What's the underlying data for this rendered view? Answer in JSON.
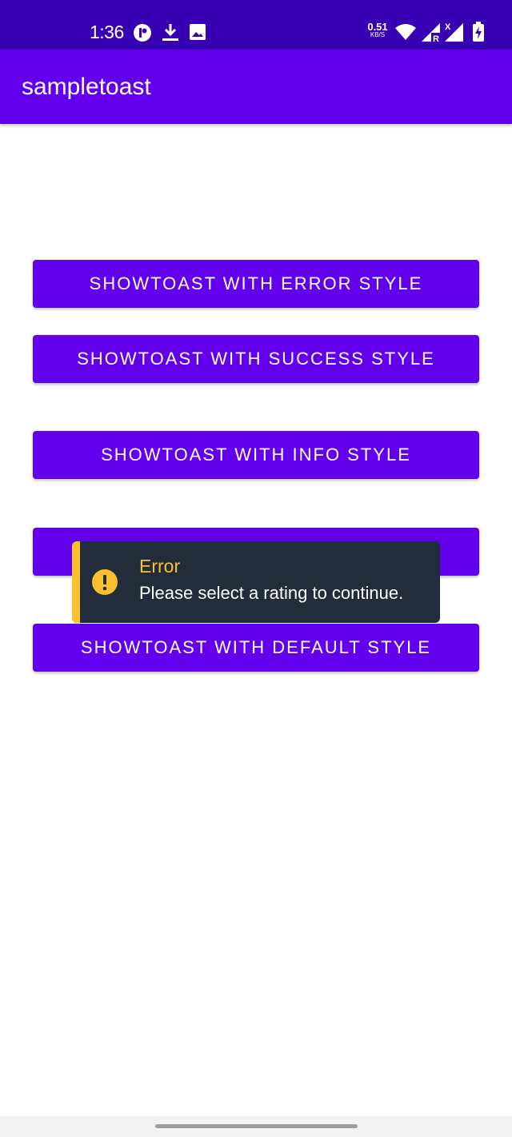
{
  "status_bar": {
    "time": "1:36",
    "net_speed_value": "0.51",
    "net_speed_unit": "KB/S",
    "icons": [
      "notification-app-icon",
      "download-icon",
      "image-icon",
      "wifi-icon",
      "signal-roaming-icon",
      "signal-no-service-icon",
      "battery-charging-icon"
    ]
  },
  "app_bar": {
    "title": "sampletoast"
  },
  "buttons": {
    "error": "SHOWTOAST WITH ERROR STYLE",
    "success": "SHOWTOAST WITH SUCCESS STYLE",
    "info": "SHOWTOAST WITH INFO STYLE",
    "warning": "",
    "default": "SHOWTOAST WITH DEFAULT STYLE"
  },
  "toast": {
    "title": "Error",
    "message": "Please select a rating to continue.",
    "icon": "alert-icon",
    "accent_color": "#fbc02d"
  },
  "colors": {
    "primary": "#6200ee",
    "primary_dark": "#3700b3",
    "toast_background": "#212d3b"
  }
}
